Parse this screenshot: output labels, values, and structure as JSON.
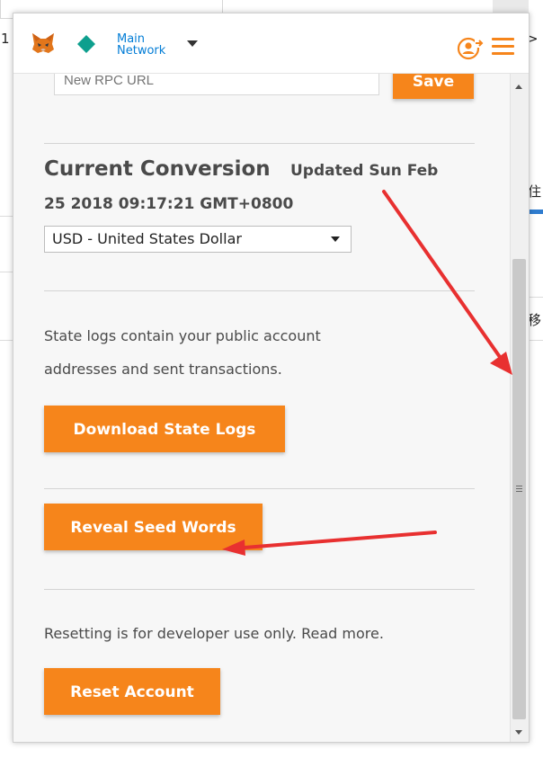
{
  "background": {
    "left_char": "1",
    "right_chars": [
      ">",
      "住",
      "移"
    ]
  },
  "header": {
    "network_line1": "Main",
    "network_line2": "Network",
    "icons": [
      "metamask-fox-icon",
      "network-diamond-icon",
      "chevron-down-icon",
      "account-switch-icon",
      "hamburger-menu-icon"
    ]
  },
  "rpc": {
    "placeholder": "New RPC URL",
    "save_label": "Save"
  },
  "conversion": {
    "title": "Current Conversion",
    "updated_line1": "Updated Sun Feb",
    "updated_line2": "25 2018 09:17:21 GMT+0800",
    "selected_currency": "USD - United States Dollar"
  },
  "state_logs": {
    "line1": "State logs contain your public account",
    "line2": "addresses and sent transactions.",
    "button_label": "Download State Logs"
  },
  "seed": {
    "button_label": "Reveal Seed Words"
  },
  "reset": {
    "text": "Resetting is for developer use only. Read more.",
    "button_label": "Reset Account"
  },
  "colors": {
    "accent": "#f6851b",
    "network": "#037dd6",
    "annotation": "#e83030"
  }
}
